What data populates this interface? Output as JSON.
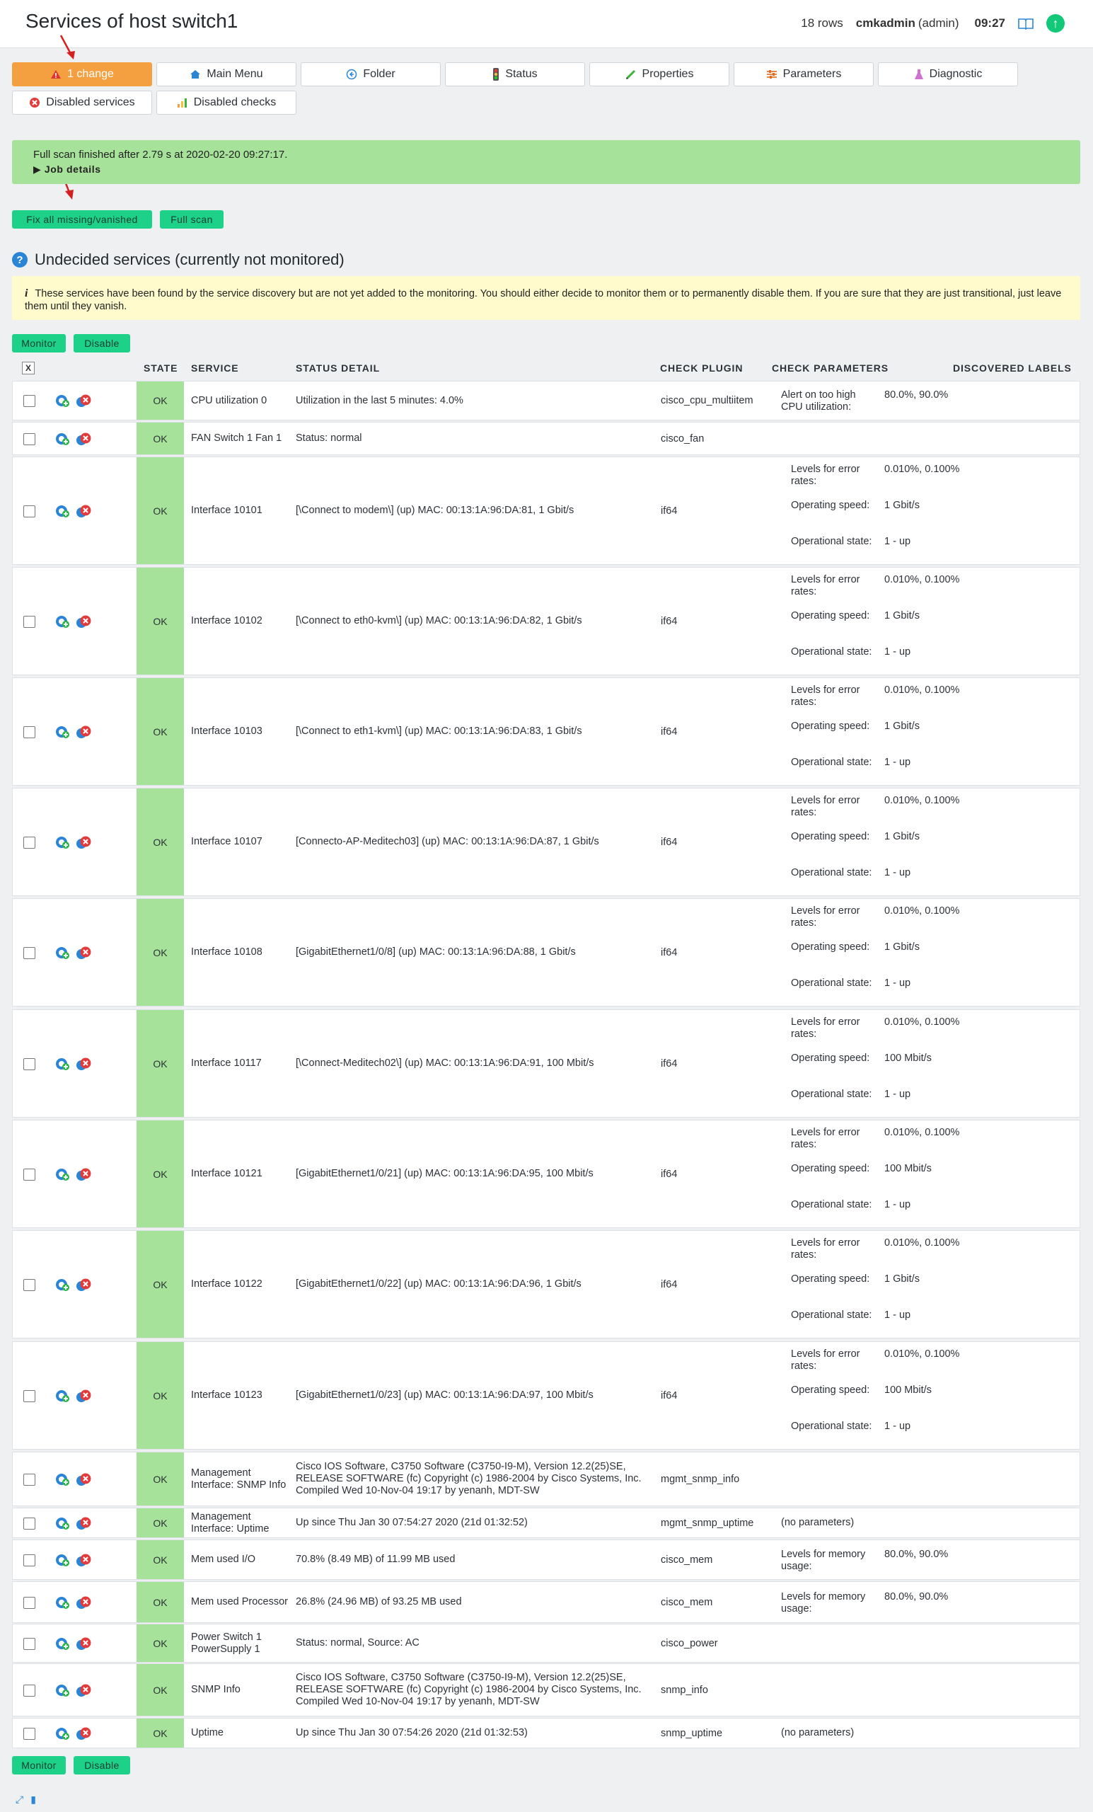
{
  "header": {
    "title": "Services of host switch1",
    "rows": "18 rows",
    "user": "cmkadmin",
    "role": "(admin)",
    "time": "09:27"
  },
  "buttons": {
    "changes": "1 change",
    "main_menu": "Main Menu",
    "folder": "Folder",
    "status": "Status",
    "properties": "Properties",
    "parameters": "Parameters",
    "diagnostic": "Diagnostic",
    "disabled_services": "Disabled services",
    "disabled_checks": "Disabled checks"
  },
  "scan_message": {
    "text": "Full scan finished after 2.79 s at 2020-02-20 09:27:17.",
    "job_details": "▶ Job details"
  },
  "actions": {
    "fix_all": "Fix all missing/vanished",
    "full_scan": "Full scan",
    "monitor": "Monitor",
    "disable": "Disable"
  },
  "section": {
    "title": "Undecided services (currently not monitored)",
    "info_icon": "i",
    "info": "These services have been found by the service discovery but are not yet added to the monitoring. You should either decide to monitor them or to permanently disable them. If you are sure that they are just transitional, just leave them until they vanish."
  },
  "table": {
    "headers": {
      "x": "X",
      "state": "STATE",
      "service": "SERVICE",
      "status_detail": "STATUS DETAIL",
      "check_plugin": "CHECK PLUGIN",
      "check_parameters": "CHECK PARAMETERS",
      "discovered_labels": "DISCOVERED LABELS"
    },
    "rows": [
      {
        "state": "OK",
        "service": "CPU utilization 0",
        "detail": "Utilization in the last 5 minutes: 4.0%",
        "plugin": "cisco_cpu_multiitem",
        "params": [
          {
            "k": "Alert on too high CPU utilization:",
            "v": "80.0%, 90.0%"
          }
        ]
      },
      {
        "state": "OK",
        "service": "FAN Switch 1 Fan 1",
        "detail": "Status: normal",
        "plugin": "cisco_fan",
        "params": []
      },
      {
        "state": "OK",
        "service": "Interface 10101",
        "detail": "[\\Connect to modem\\] (up) MAC: 00:13:1A:96:DA:81, 1 Gbit/s",
        "plugin": "if64",
        "params": [
          {
            "k": "Levels for error rates:",
            "v": "0.010%, 0.100%"
          },
          {
            "k": "Operating speed:",
            "v": "1 Gbit/s"
          },
          {
            "k": "Operational state:",
            "v": "1 - up"
          }
        ]
      },
      {
        "state": "OK",
        "service": "Interface 10102",
        "detail": "[\\Connect to eth0-kvm\\] (up) MAC: 00:13:1A:96:DA:82, 1 Gbit/s",
        "plugin": "if64",
        "params": [
          {
            "k": "Levels for error rates:",
            "v": "0.010%, 0.100%"
          },
          {
            "k": "Operating speed:",
            "v": "1 Gbit/s"
          },
          {
            "k": "Operational state:",
            "v": "1 - up"
          }
        ]
      },
      {
        "state": "OK",
        "service": "Interface 10103",
        "detail": "[\\Connect to eth1-kvm\\] (up) MAC: 00:13:1A:96:DA:83, 1 Gbit/s",
        "plugin": "if64",
        "params": [
          {
            "k": "Levels for error rates:",
            "v": "0.010%, 0.100%"
          },
          {
            "k": "Operating speed:",
            "v": "1 Gbit/s"
          },
          {
            "k": "Operational state:",
            "v": "1 - up"
          }
        ]
      },
      {
        "state": "OK",
        "service": "Interface 10107",
        "detail": "[Connecto-AP-Meditech03] (up) MAC: 00:13:1A:96:DA:87, 1 Gbit/s",
        "plugin": "if64",
        "params": [
          {
            "k": "Levels for error rates:",
            "v": "0.010%, 0.100%"
          },
          {
            "k": "Operating speed:",
            "v": "1 Gbit/s"
          },
          {
            "k": "Operational state:",
            "v": "1 - up"
          }
        ]
      },
      {
        "state": "OK",
        "service": "Interface 10108",
        "detail": "[GigabitEthernet1/0/8] (up) MAC: 00:13:1A:96:DA:88, 1 Gbit/s",
        "plugin": "if64",
        "params": [
          {
            "k": "Levels for error rates:",
            "v": "0.010%, 0.100%"
          },
          {
            "k": "Operating speed:",
            "v": "1 Gbit/s"
          },
          {
            "k": "Operational state:",
            "v": "1 - up"
          }
        ]
      },
      {
        "state": "OK",
        "service": "Interface 10117",
        "detail": "[\\Connect-Meditech02\\] (up) MAC: 00:13:1A:96:DA:91, 100 Mbit/s",
        "plugin": "if64",
        "params": [
          {
            "k": "Levels for error rates:",
            "v": "0.010%, 0.100%"
          },
          {
            "k": "Operating speed:",
            "v": "100 Mbit/s"
          },
          {
            "k": "Operational state:",
            "v": "1 - up"
          }
        ]
      },
      {
        "state": "OK",
        "service": "Interface 10121",
        "detail": "[GigabitEthernet1/0/21] (up) MAC: 00:13:1A:96:DA:95, 100 Mbit/s",
        "plugin": "if64",
        "params": [
          {
            "k": "Levels for error rates:",
            "v": "0.010%, 0.100%"
          },
          {
            "k": "Operating speed:",
            "v": "100 Mbit/s"
          },
          {
            "k": "Operational state:",
            "v": "1 - up"
          }
        ]
      },
      {
        "state": "OK",
        "service": "Interface 10122",
        "detail": "[GigabitEthernet1/0/22] (up) MAC: 00:13:1A:96:DA:96, 1 Gbit/s",
        "plugin": "if64",
        "params": [
          {
            "k": "Levels for error rates:",
            "v": "0.010%, 0.100%"
          },
          {
            "k": "Operating speed:",
            "v": "1 Gbit/s"
          },
          {
            "k": "Operational state:",
            "v": "1 - up"
          }
        ]
      },
      {
        "state": "OK",
        "service": "Interface 10123",
        "detail": "[GigabitEthernet1/0/23] (up) MAC: 00:13:1A:96:DA:97, 100 Mbit/s",
        "plugin": "if64",
        "params": [
          {
            "k": "Levels for error rates:",
            "v": "0.010%, 0.100%"
          },
          {
            "k": "Operating speed:",
            "v": "100 Mbit/s"
          },
          {
            "k": "Operational state:",
            "v": "1 - up"
          }
        ]
      },
      {
        "state": "OK",
        "service": "Management Interface: SNMP Info",
        "detail": "Cisco IOS Software, C3750 Software (C3750-I9-M), Version 12.2(25)SE, RELEASE SOFTWARE (fc) Copyright (c) 1986-2004 by Cisco Systems, Inc. Compiled Wed 10-Nov-04 19:17 by yenanh, MDT-SW",
        "plugin": "mgmt_snmp_info",
        "params": []
      },
      {
        "state": "OK",
        "service": "Management Interface: Uptime",
        "detail": "Up since Thu Jan 30 07:54:27 2020 (21d 01:32:52)",
        "plugin": "mgmt_snmp_uptime",
        "param_text": "(no parameters)",
        "params": []
      },
      {
        "state": "OK",
        "service": "Mem used I/O",
        "detail": "70.8% (8.49 MB) of 11.99 MB used",
        "plugin": "cisco_mem",
        "params": [
          {
            "k": "Levels for memory usage:",
            "v": "80.0%, 90.0%"
          }
        ]
      },
      {
        "state": "OK",
        "service": "Mem used Processor",
        "detail": "26.8% (24.96 MB) of 93.25 MB used",
        "plugin": "cisco_mem",
        "params": [
          {
            "k": "Levels for memory usage:",
            "v": "80.0%, 90.0%"
          }
        ]
      },
      {
        "state": "OK",
        "service": "Power Switch 1 PowerSupply 1",
        "detail": "Status: normal, Source: AC",
        "plugin": "cisco_power",
        "params": []
      },
      {
        "state": "OK",
        "service": "SNMP Info",
        "detail": "Cisco IOS Software, C3750 Software (C3750-I9-M), Version 12.2(25)SE, RELEASE SOFTWARE (fc) Copyright (c) 1986-2004 by Cisco Systems, Inc. Compiled Wed 10-Nov-04 19:17 by yenanh, MDT-SW",
        "plugin": "snmp_info",
        "params": []
      },
      {
        "state": "OK",
        "service": "Uptime",
        "detail": "Up since Thu Jan 30 07:54:26 2020 (21d 01:32:53)",
        "plugin": "snmp_uptime",
        "param_text": "(no parameters)",
        "params": []
      }
    ]
  },
  "colors": {
    "ok_green": "#a6e29a",
    "action_green": "#1ed189",
    "change_orange": "#f5a040",
    "info_yellow": "#fffbcd"
  }
}
